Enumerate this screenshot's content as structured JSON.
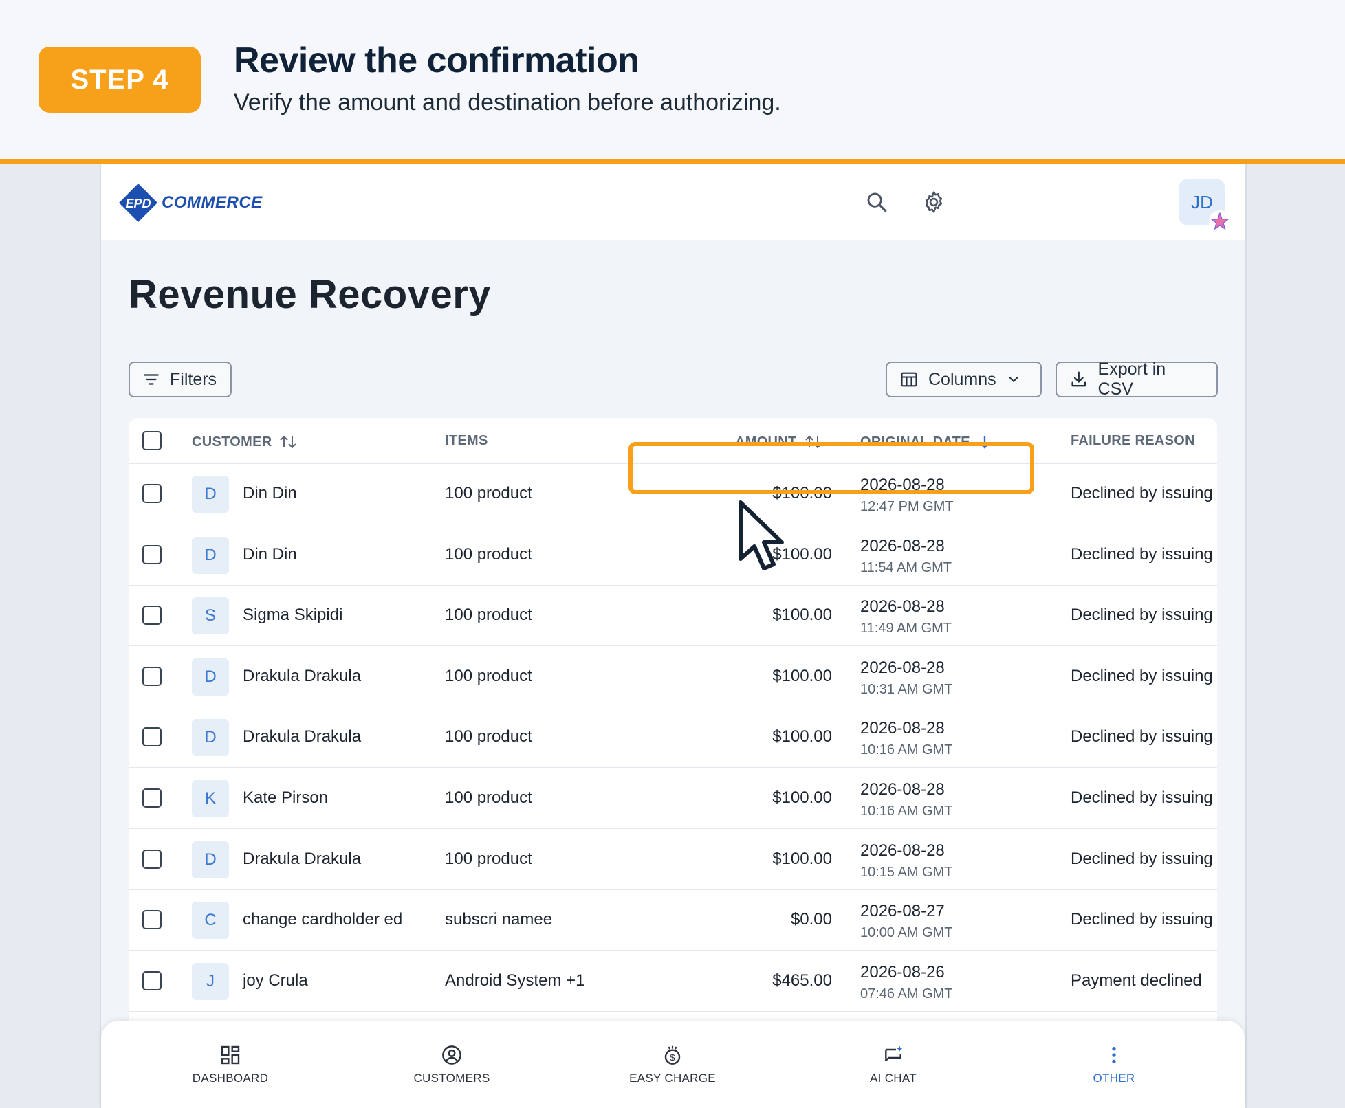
{
  "banner": {
    "step": "STEP 4",
    "title": "Review the confirmation",
    "subtitle": "Verify the amount and destination before authorizing."
  },
  "header": {
    "logo_mark": "EPD",
    "logo_text": "COMMERCE",
    "avatar_initials": "JD"
  },
  "page": {
    "title": "Revenue Recovery"
  },
  "toolbar": {
    "filters_label": "Filters",
    "columns_label": "Columns",
    "export_label": "Export in CSV"
  },
  "table": {
    "columns": {
      "customer": "CUSTOMER",
      "items": "ITEMS",
      "amount": "AMOUNT",
      "original_date": "ORIGINAL DATE",
      "failure_reason": "FAILURE REASON"
    },
    "rows": [
      {
        "initial": "D",
        "customer": "Din Din",
        "items": "100 product",
        "amount": "$100.00",
        "date": "2026-08-28",
        "time": "12:47 PM GMT",
        "reason": "Declined by issuing"
      },
      {
        "initial": "D",
        "customer": "Din Din",
        "items": "100 product",
        "amount": "$100.00",
        "date": "2026-08-28",
        "time": "11:54 AM GMT",
        "reason": "Declined by issuing"
      },
      {
        "initial": "S",
        "customer": "Sigma Skipidi",
        "items": "100 product",
        "amount": "$100.00",
        "date": "2026-08-28",
        "time": "11:49 AM GMT",
        "reason": "Declined by issuing"
      },
      {
        "initial": "D",
        "customer": "Drakula Drakula",
        "items": "100 product",
        "amount": "$100.00",
        "date": "2026-08-28",
        "time": "10:31 AM GMT",
        "reason": "Declined by issuing"
      },
      {
        "initial": "D",
        "customer": "Drakula Drakula",
        "items": "100 product",
        "amount": "$100.00",
        "date": "2026-08-28",
        "time": "10:16 AM GMT",
        "reason": "Declined by issuing"
      },
      {
        "initial": "K",
        "customer": "Kate Pirson",
        "items": "100 product",
        "amount": "$100.00",
        "date": "2026-08-28",
        "time": "10:16 AM GMT",
        "reason": "Declined by issuing"
      },
      {
        "initial": "D",
        "customer": "Drakula Drakula",
        "items": "100 product",
        "amount": "$100.00",
        "date": "2026-08-28",
        "time": "10:15 AM GMT",
        "reason": "Declined by issuing"
      },
      {
        "initial": "C",
        "customer": "change cardholder ed",
        "items": "subscri namee",
        "amount": "$0.00",
        "date": "2026-08-27",
        "time": "10:00 AM GMT",
        "reason": "Declined by issuing"
      },
      {
        "initial": "J",
        "customer": "joy Crula",
        "items": "Android System +1",
        "amount": "$465.00",
        "date": "2026-08-26",
        "time": "07:46 AM GMT",
        "reason": "Payment declined"
      }
    ]
  },
  "nav": {
    "dashboard": "DASHBOARD",
    "customers": "CUSTOMERS",
    "easy_charge": "EASY CHARGE",
    "ai_chat": "AI CHAT",
    "other": "OTHER"
  },
  "colors": {
    "accent": "#f7a01a",
    "brand": "#2f6fcc"
  }
}
